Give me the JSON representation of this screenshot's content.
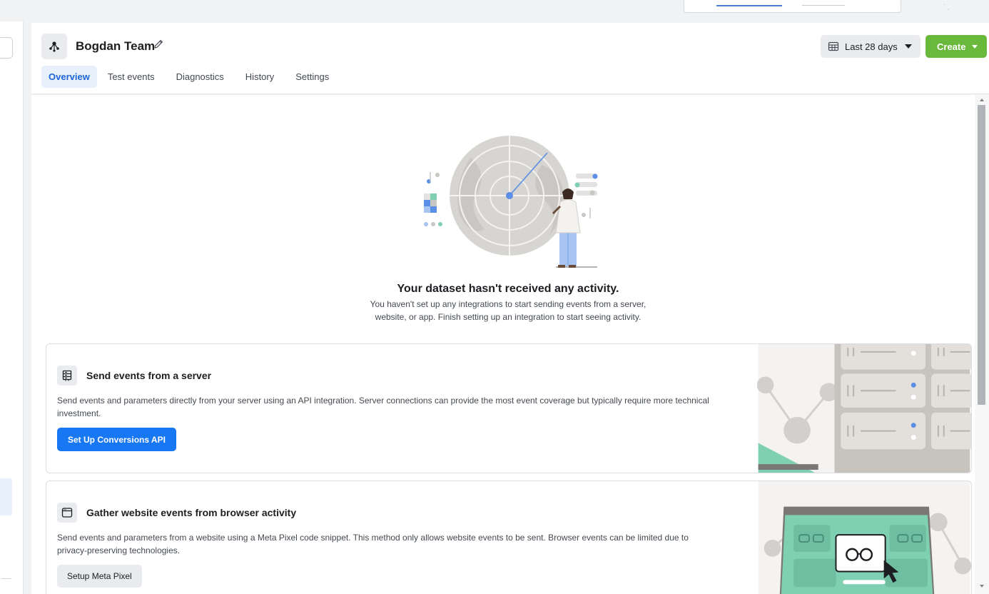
{
  "dataset": {
    "name": "Bogdan Team"
  },
  "tabs": [
    {
      "label": "Overview",
      "active": true
    },
    {
      "label": "Test events",
      "active": false
    },
    {
      "label": "Diagnostics",
      "active": false
    },
    {
      "label": "History",
      "active": false
    },
    {
      "label": "Settings",
      "active": false
    }
  ],
  "toolbar": {
    "date_range": "Last 28 days",
    "create_label": "Create"
  },
  "empty_state": {
    "title": "Your dataset hasn't received any activity.",
    "description": "You haven't set up any integrations to start sending events from a server, website, or app. Finish setting up an integration to start seeing activity."
  },
  "cards": [
    {
      "icon": "server-icon",
      "title": "Send events from a server",
      "description": "Send events and parameters directly from your server using an API integration. Server connections can provide the most event coverage but typically require more technical investment.",
      "button": "Set Up Conversions API"
    },
    {
      "icon": "browser-window-icon",
      "title": "Gather website events from browser activity",
      "description": "Send events and parameters from a website using a Meta Pixel code snippet. This method only allows website events to be sent. Browser events can be limited due to privacy-preserving technologies.",
      "button": "Setup Meta Pixel"
    }
  ],
  "colors": {
    "accent": "#1877f2",
    "create": "#6bb93c",
    "tab_active_bg": "#e7f0fb",
    "illustration_green": "#7fcfb2"
  }
}
